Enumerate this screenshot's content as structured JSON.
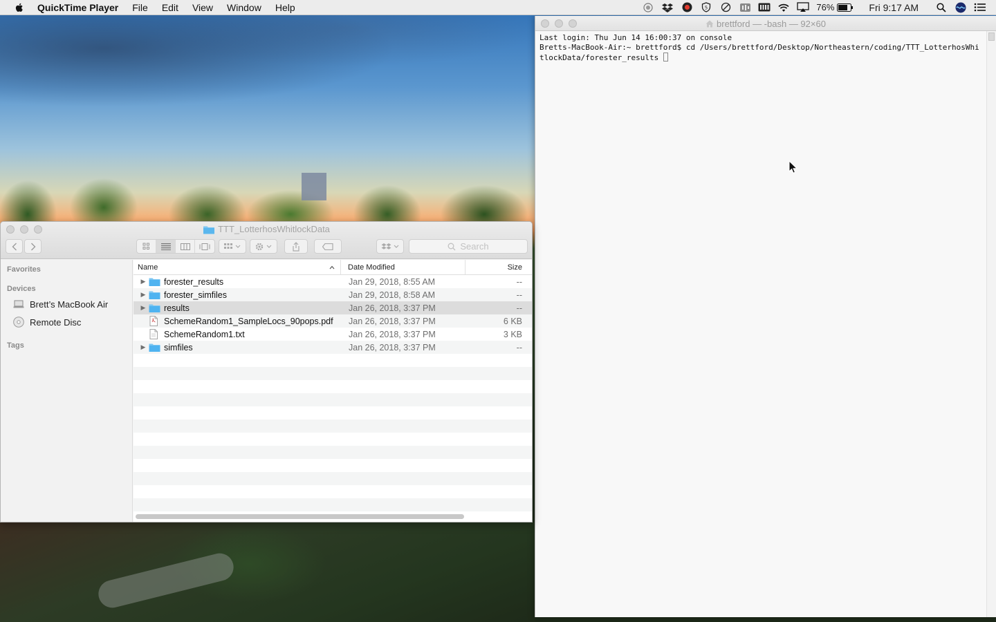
{
  "menubar": {
    "app_name": "QuickTime Player",
    "items": [
      "File",
      "Edit",
      "View",
      "Window",
      "Help"
    ],
    "battery_percent": "76%",
    "clock": "Fri 9:17 AM"
  },
  "terminal": {
    "title": "brettford — -bash — 92×60",
    "line1": "Last login: Thu Jun 14 16:00:37 on console",
    "line2": "Bretts-MacBook-Air:~ brettford$ cd /Users/brettford/Desktop/Northeastern/coding/TTT_LotterhosWhitlockData/forester_results "
  },
  "finder": {
    "title": "TTT_LotterhosWhitlockData",
    "search_placeholder": "Search",
    "sidebar": {
      "favorites_label": "Favorites",
      "devices_label": "Devices",
      "devices": [
        "Brett’s MacBook Air",
        "Remote Disc"
      ],
      "tags_label": "Tags"
    },
    "columns": {
      "name": "Name",
      "date": "Date Modified",
      "size": "Size"
    },
    "files": [
      {
        "name": "forester_results",
        "date": "Jan 29, 2018, 8:55 AM",
        "size": "--",
        "type": "folder"
      },
      {
        "name": "forester_simfiles",
        "date": "Jan 29, 2018, 8:58 AM",
        "size": "--",
        "type": "folder"
      },
      {
        "name": "results",
        "date": "Jan 26, 2018, 3:37 PM",
        "size": "--",
        "type": "folder"
      },
      {
        "name": "SchemeRandom1_SampleLocs_90pops.pdf",
        "date": "Jan 26, 2018, 3:37 PM",
        "size": "6 KB",
        "type": "file"
      },
      {
        "name": "SchemeRandom1.txt",
        "date": "Jan 26, 2018, 3:37 PM",
        "size": "3 KB",
        "type": "file"
      },
      {
        "name": "simfiles",
        "date": "Jan 26, 2018, 3:37 PM",
        "size": "--",
        "type": "folder"
      }
    ]
  },
  "colors": {
    "folder_blue": "#4fb3f0",
    "menubar_bg": "#ececec"
  }
}
